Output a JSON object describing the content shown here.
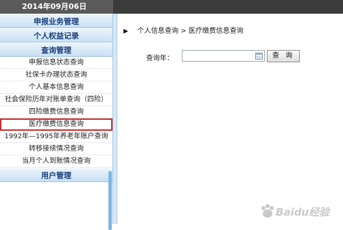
{
  "header": {
    "date": "2014年09月06日"
  },
  "sidebar": {
    "sections": [
      {
        "label": "申报业务管理"
      },
      {
        "label": "个人权益记录"
      },
      {
        "label": "查询管理"
      }
    ],
    "items": [
      {
        "label": "申报信息状态查询"
      },
      {
        "label": "社保卡办理状态查询"
      },
      {
        "label": "个人基本信息查询"
      },
      {
        "label": "社会保险历年对账单查询（四险）"
      },
      {
        "label": "四险缴费信息查询"
      },
      {
        "label": "医疗缴费信息查询"
      },
      {
        "label": "1992年—1995年养老年账户查询"
      },
      {
        "label": "转移接续情况查询"
      },
      {
        "label": "当月个人到账情况查询"
      }
    ],
    "bottom_section": {
      "label": "用户管理"
    },
    "selected_item": "医疗缴费信息查询"
  },
  "breadcrumb": {
    "part1": "个人信息查询",
    "separator": ">",
    "part2": "医疗缴费信息查询"
  },
  "query_form": {
    "year_label": "查询年：",
    "year_value": "",
    "search_label": "查 询"
  },
  "watermark": {
    "text": "Baidu经验"
  },
  "colors": {
    "topbar": "#3b3b3b",
    "section_text": "#1a3f7a",
    "highlight_border": "#cc2a2a"
  }
}
